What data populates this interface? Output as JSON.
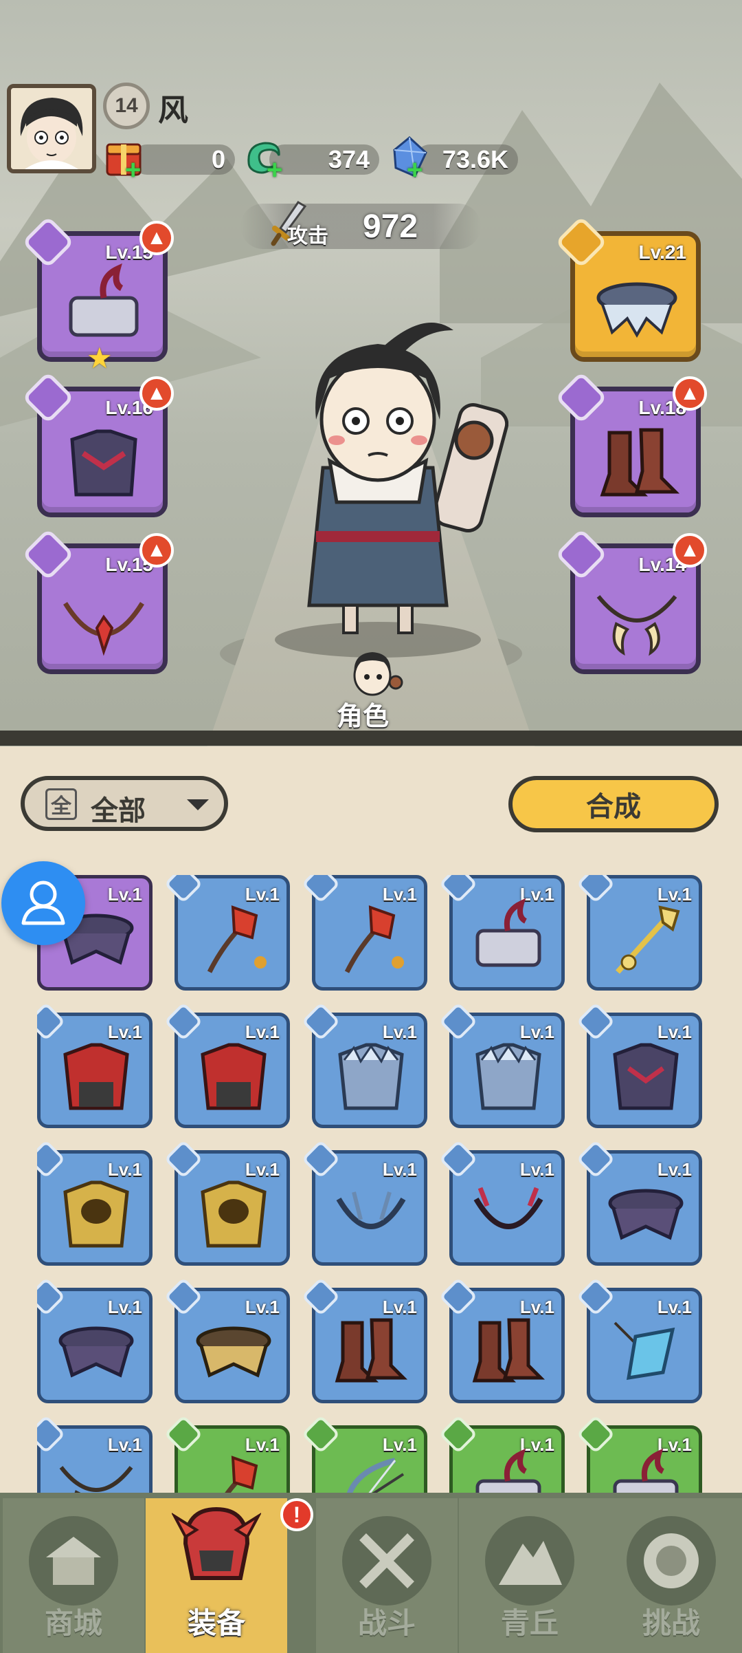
{
  "player": {
    "level": "14",
    "name": "风"
  },
  "resources": [
    {
      "icon": "gift-box-icon",
      "value": "0"
    },
    {
      "icon": "jade-dragon-icon",
      "value": "374"
    },
    {
      "icon": "crystal-icon",
      "value": "73.6K"
    }
  ],
  "attack": {
    "label": "攻击",
    "value": "972"
  },
  "equipped": {
    "left": [
      {
        "type": "weapon",
        "level": "Lv.15",
        "upgrade": true,
        "star": true,
        "item": "hammer"
      },
      {
        "type": "armor",
        "level": "Lv.16",
        "upgrade": true,
        "item": "armor"
      },
      {
        "type": "accessory",
        "level": "Lv.15",
        "upgrade": true,
        "item": "necklace"
      }
    ],
    "right": [
      {
        "type": "belt",
        "level": "Lv.21",
        "upgrade": false,
        "rarity": "gold",
        "item": "belt"
      },
      {
        "type": "boots",
        "level": "Lv.18",
        "upgrade": true,
        "item": "boots"
      },
      {
        "type": "ring",
        "level": "Lv.14",
        "upgrade": true,
        "item": "claws"
      }
    ]
  },
  "character_label": "角色",
  "filter": {
    "icon_text": "全",
    "label": "全部"
  },
  "combine_label": "合成",
  "inventory": [
    {
      "level": "Lv.1",
      "rarity": "purple",
      "item": "belt"
    },
    {
      "level": "Lv.1",
      "rarity": "blue",
      "item": "flower-staff"
    },
    {
      "level": "Lv.1",
      "rarity": "blue",
      "item": "flower-staff"
    },
    {
      "level": "Lv.1",
      "rarity": "blue",
      "item": "hammer"
    },
    {
      "level": "Lv.1",
      "rarity": "blue",
      "item": "golden-staff"
    },
    {
      "level": "Lv.1",
      "rarity": "blue",
      "item": "red-armor"
    },
    {
      "level": "Lv.1",
      "rarity": "blue",
      "item": "red-armor"
    },
    {
      "level": "Lv.1",
      "rarity": "blue",
      "item": "ice-armor"
    },
    {
      "level": "Lv.1",
      "rarity": "blue",
      "item": "ice-armor"
    },
    {
      "level": "Lv.1",
      "rarity": "blue",
      "item": "dark-armor"
    },
    {
      "level": "Lv.1",
      "rarity": "blue",
      "item": "gold-armor"
    },
    {
      "level": "Lv.1",
      "rarity": "blue",
      "item": "gold-armor"
    },
    {
      "level": "Lv.1",
      "rarity": "blue",
      "item": "dark-necklace"
    },
    {
      "level": "Lv.1",
      "rarity": "blue",
      "item": "red-necklace"
    },
    {
      "level": "Lv.1",
      "rarity": "blue",
      "item": "belt"
    },
    {
      "level": "Lv.1",
      "rarity": "blue",
      "item": "belt"
    },
    {
      "level": "Lv.1",
      "rarity": "blue",
      "item": "gold-belt"
    },
    {
      "level": "Lv.1",
      "rarity": "blue",
      "item": "boots"
    },
    {
      "level": "Lv.1",
      "rarity": "blue",
      "item": "boots"
    },
    {
      "level": "Lv.1",
      "rarity": "blue",
      "item": "pendant"
    },
    {
      "level": "Lv.1",
      "rarity": "blue",
      "item": "claws"
    },
    {
      "level": "Lv.1",
      "rarity": "green",
      "item": "flower-staff"
    },
    {
      "level": "Lv.1",
      "rarity": "green",
      "item": "bow"
    },
    {
      "level": "Lv.1",
      "rarity": "green",
      "item": "hammer"
    },
    {
      "level": "Lv.1",
      "rarity": "green",
      "item": "hammer"
    }
  ],
  "nav": [
    {
      "label": "商城",
      "icon": "shop-icon",
      "active": false
    },
    {
      "label": "装备",
      "icon": "helmet-icon",
      "active": true,
      "alert": "!"
    },
    {
      "label": "战斗",
      "icon": "crossed-swords-icon",
      "active": false
    },
    {
      "label": "青丘",
      "icon": "mountain-icon",
      "active": false
    },
    {
      "label": "挑战",
      "icon": "challenge-orb-icon",
      "active": false
    }
  ],
  "colors": {
    "purple_rarity": "#a979d6",
    "blue_rarity": "#6b9fd9",
    "green_rarity": "#6dbb52",
    "gold_rarity": "#f2b537",
    "combine_button": "#f7c648",
    "upgrade_badge": "#e24a2c",
    "nav_active": "#e9c05a"
  }
}
